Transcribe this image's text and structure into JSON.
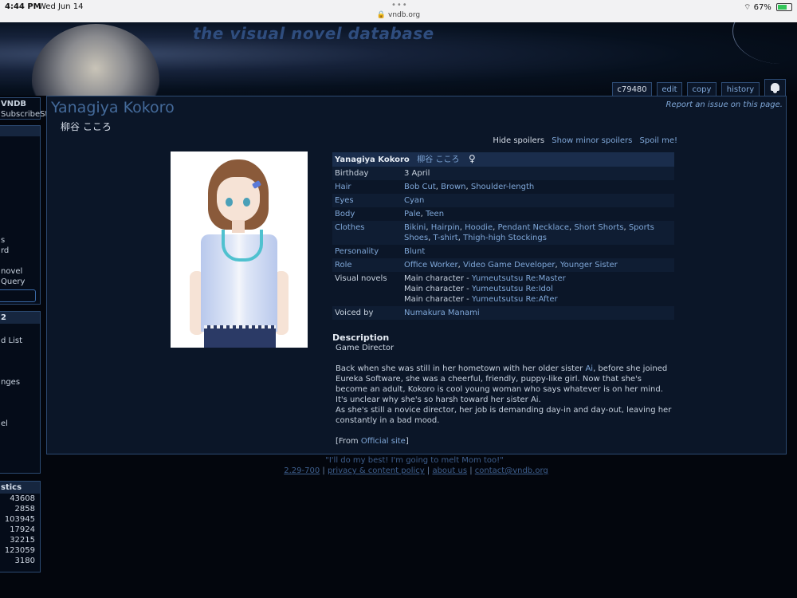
{
  "status_bar": {
    "time": "4:44 PM",
    "date": "Wed Jun 14",
    "url": "vndb.org",
    "battery": "67%",
    "battery_level": 0.67
  },
  "header": {
    "logo_text": "the visual novel database"
  },
  "sidebar": {
    "box1_lines": [
      "VNDB",
      "SubscribeStar"
    ],
    "box2_lines": [
      "s",
      "rd",
      "novel",
      "Query"
    ],
    "box3_title": "2",
    "box3_lines": [
      "d List",
      "nges",
      "el"
    ],
    "stats_title": "stics",
    "stats": [
      "43608",
      "2858",
      "103945",
      "17924",
      "32215",
      "123059",
      "3180"
    ]
  },
  "tabs": {
    "id": "c79480",
    "edit": "edit",
    "copy": "copy",
    "history": "history",
    "bell_icon": "bell-icon"
  },
  "character": {
    "name": "Yanagiya Kokoro",
    "original_name": "柳谷 こころ",
    "report_link": "Report an issue on this page.",
    "spoilers": {
      "current": "Hide spoilers",
      "minor": "Show minor spoilers",
      "all": "Spoil me!"
    },
    "info_header": {
      "name": "Yanagiya Kokoro",
      "original": "柳谷 こころ",
      "gender_symbol": "♀"
    },
    "birthday_label": "Birthday",
    "birthday": "3 April",
    "traits": [
      {
        "label": "Hair",
        "values": [
          "Bob Cut",
          "Brown",
          "Shoulder-length"
        ]
      },
      {
        "label": "Eyes",
        "values": [
          "Cyan"
        ]
      },
      {
        "label": "Body",
        "values": [
          "Pale",
          "Teen"
        ]
      },
      {
        "label": "Clothes",
        "values": [
          "Bikini",
          "Hairpin",
          "Hoodie",
          "Pendant Necklace",
          "Short Shorts",
          "Sports Shoes",
          "T-shirt",
          "Thigh-high Stockings"
        ]
      },
      {
        "label": "Personality",
        "values": [
          "Blunt"
        ]
      },
      {
        "label": "Role",
        "values": [
          "Office Worker",
          "Video Game Developer",
          "Younger Sister"
        ]
      }
    ],
    "visual_novels_label": "Visual novels",
    "visual_novels": [
      {
        "role": "Main character - ",
        "title": "Yumeutsutsu Re:Master"
      },
      {
        "role": "Main character - ",
        "title": "Yumeutsutsu Re:Idol"
      },
      {
        "role": "Main character - ",
        "title": "Yumeutsutsu Re:After"
      }
    ],
    "voiced_by_label": "Voiced by",
    "voiced_by": "Numakura Manami",
    "description_title": "Description",
    "description": {
      "line1": "Game Director",
      "p1_a": "Back when she was still in her hometown with her older sister ",
      "p1_link": "Ai",
      "p1_b": ", before she joined Eureka Software, she was a cheerful, friendly, puppy-like girl. Now that she's become an adult, Kokoro is cool young woman who says whatever is on her mind.",
      "p2": "It's unclear why she's so harsh toward her sister Ai.",
      "p3": "As she's still a novice director, her job is demanding day-in and day-out, leaving her constantly in a bad mood.",
      "from_a": "[From ",
      "from_link": "Official site",
      "from_b": "]"
    }
  },
  "footer": {
    "quote": "\"I'll do my best! I'm going to melt Mom too!\"",
    "links": [
      "2.29-700",
      "privacy & content policy",
      "about us",
      "contact@vndb.org"
    ]
  }
}
